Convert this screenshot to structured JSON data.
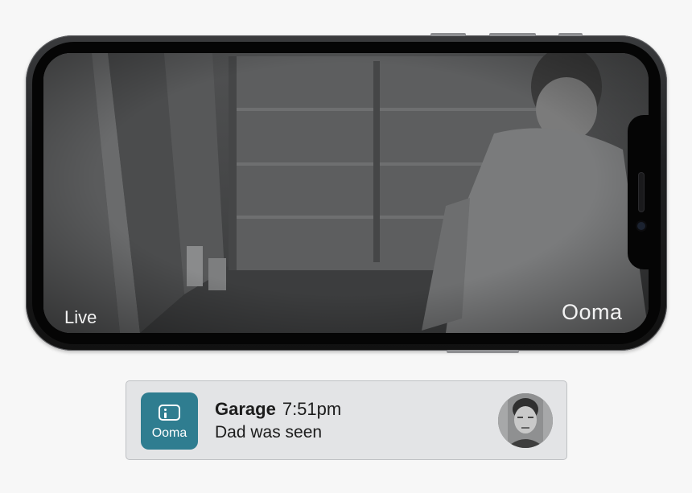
{
  "camera_view": {
    "status_label": "Live",
    "brand_watermark": "Ooma"
  },
  "notification": {
    "app_icon_icon": "camera-icon",
    "app_name": "Ooma",
    "location": "Garage",
    "time": "7:51pm",
    "message": "Dad was seen",
    "accent_color": "#2f7d90"
  }
}
